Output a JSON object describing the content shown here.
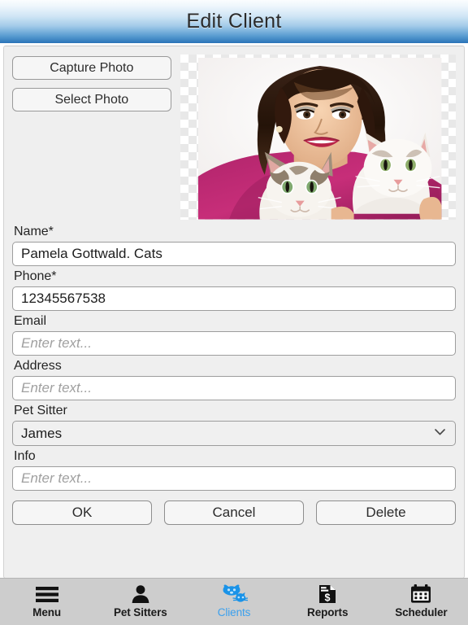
{
  "header": {
    "title": "Edit Client"
  },
  "photo": {
    "capture_label": "Capture Photo",
    "select_label": "Select Photo",
    "image_alt": "woman-with-two-cats-photo",
    "transparency_checkerboard": true
  },
  "form": {
    "fields": [
      {
        "label": "Name*",
        "value": "Pamela Gottwald. Cats",
        "placeholder": "Enter text...",
        "type": "text"
      },
      {
        "label": "Phone*",
        "value": "12345567538",
        "placeholder": "Enter text...",
        "type": "text"
      },
      {
        "label": "Email",
        "value": "",
        "placeholder": "Enter text...",
        "type": "text"
      },
      {
        "label": "Address",
        "value": "",
        "placeholder": "Enter text...",
        "type": "text"
      },
      {
        "label": "Pet Sitter",
        "value": "James",
        "placeholder": "",
        "type": "select"
      },
      {
        "label": "Info",
        "value": "",
        "placeholder": "Enter text...",
        "type": "text"
      }
    ]
  },
  "actions": {
    "ok_label": "OK",
    "cancel_label": "Cancel",
    "delete_label": "Delete"
  },
  "tabbar": {
    "active_color": "#3aa0ee",
    "tabs": [
      {
        "label": "Menu",
        "icon": "hamburger-menu-icon",
        "active": false
      },
      {
        "label": "Pet Sitters",
        "icon": "person-icon",
        "active": false
      },
      {
        "label": "Clients",
        "icon": "dog-cat-icon",
        "active": true
      },
      {
        "label": "Reports",
        "icon": "document-dollar-icon",
        "active": false
      },
      {
        "label": "Scheduler",
        "icon": "calendar-icon",
        "active": false
      }
    ]
  }
}
